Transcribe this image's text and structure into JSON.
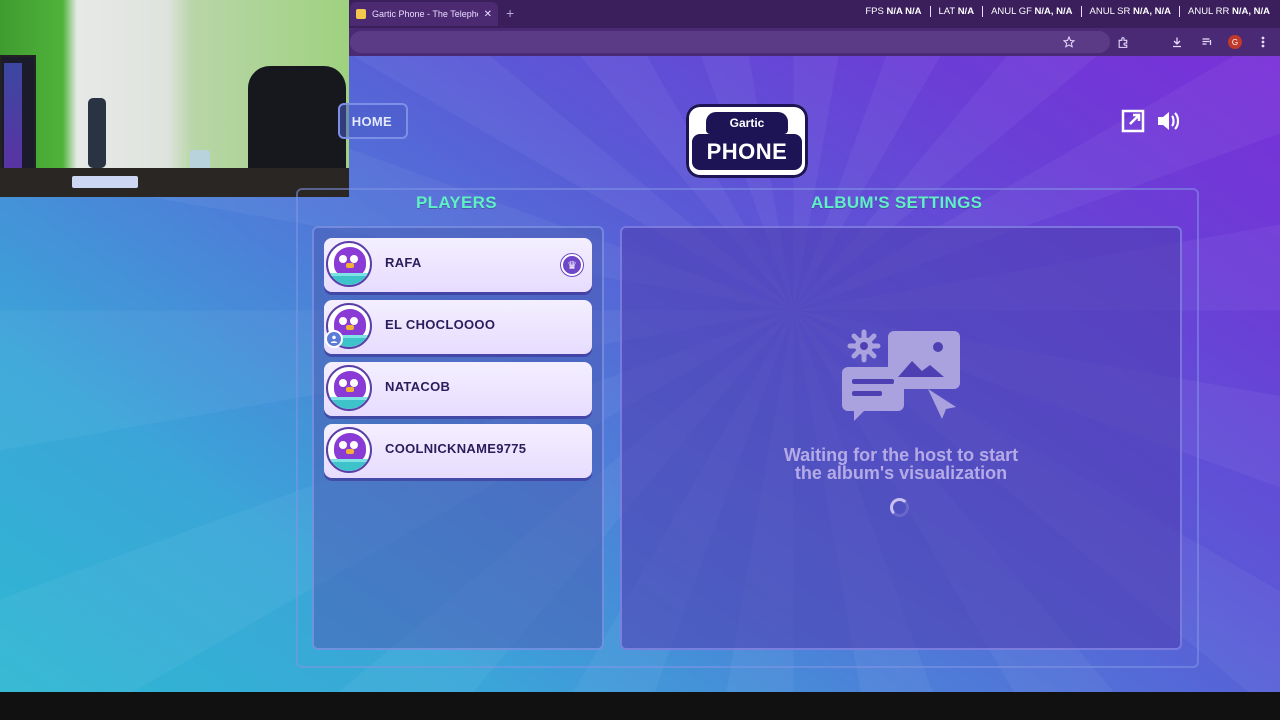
{
  "browser": {
    "tab_title": "Gartic Phone - The Telephone G",
    "tab_close": "✕",
    "new_tab": "+",
    "stats": [
      {
        "label": "FPS",
        "value": "N/A  N/A"
      },
      {
        "label": "LAT",
        "value": "N/A"
      },
      {
        "label": "ANUL GF",
        "value": "N/A, N/A"
      },
      {
        "label": "ANUL SR",
        "value": "N/A, N/A"
      },
      {
        "label": "ANUL RR",
        "value": "N/A, N/A"
      }
    ],
    "profile_initial": "G",
    "toolbar_icons": [
      "star-icon",
      "extensions-icon",
      "download-icon",
      "media-icon",
      "profile-icon",
      "menu-icon"
    ]
  },
  "game": {
    "home_label": "HOME",
    "logo_top": "Gartic",
    "logo_main": "PHONE",
    "players_title": "PLAYERS",
    "album_title": "ALBUM'S SETTINGS",
    "players": [
      {
        "name": "RAFA",
        "badge": "host"
      },
      {
        "name": "EL CHOCLOOOO",
        "badge": "you"
      },
      {
        "name": "NATACOB",
        "badge": ""
      },
      {
        "name": "COOLNICKNAME9775",
        "badge": ""
      }
    ],
    "waiting_line1": "Waiting for the host to start",
    "waiting_line2": "the album's visualization"
  },
  "colors": {
    "accent_title": "#5ff0c4",
    "player_card": "#efe8ff",
    "crown_badge": "#6e46c8"
  }
}
